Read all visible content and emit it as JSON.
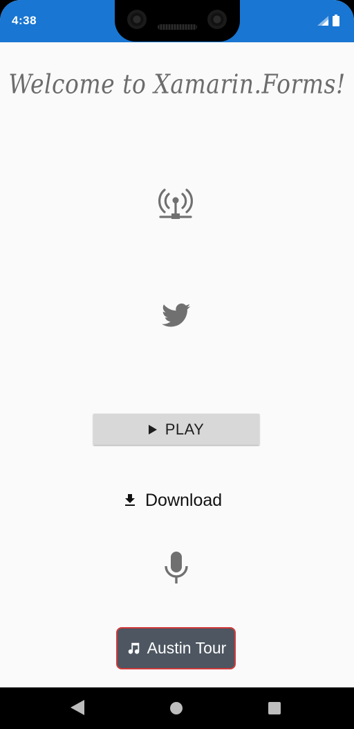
{
  "status_bar": {
    "time": "4:38",
    "background_color": "#1976d2",
    "icons": [
      "signal-icon",
      "battery-icon"
    ]
  },
  "main": {
    "title": "Welcome to Xamarin.Forms!",
    "title_color": "#6c6c6c",
    "icons": [
      "antenna-icon",
      "twitter-icon",
      "microphone-icon"
    ],
    "play_button": {
      "label": "PLAY",
      "icon": "play-icon"
    },
    "download_button": {
      "label": "Download",
      "icon": "download-icon"
    },
    "tour_button": {
      "label": "Austin Tour",
      "icon": "music-note-icon",
      "background_color": "#4d5661",
      "border_color": "#d23a3a"
    }
  },
  "nav_bar": {
    "buttons": [
      "back-icon",
      "home-icon",
      "recents-icon"
    ]
  }
}
